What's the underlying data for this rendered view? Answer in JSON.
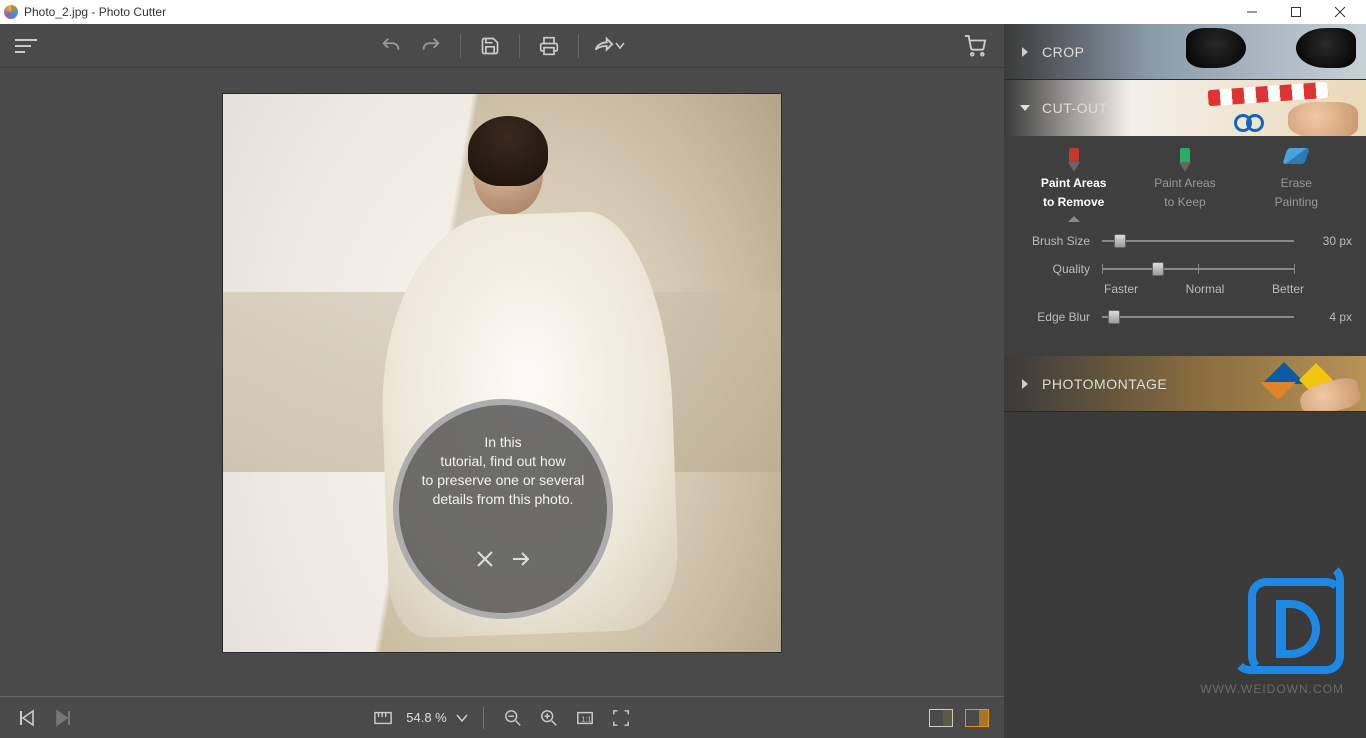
{
  "titlebar": {
    "text": "Photo_2.jpg - Photo Cutter"
  },
  "toolbar": {
    "undo": "Undo",
    "redo": "Redo",
    "save": "Save",
    "print": "Print",
    "share": "Share",
    "cart": "Store"
  },
  "tutorial": {
    "l1": "In this",
    "l2": "tutorial, find out how",
    "l3": "to preserve one or several",
    "l4": "details from this photo."
  },
  "bottombar": {
    "zoom": "54.8 %"
  },
  "panels": {
    "crop": "CROP",
    "cutout": "CUT-OUT",
    "photomontage": "PHOTOMONTAGE"
  },
  "cutout": {
    "tools": {
      "remove_l1": "Paint Areas",
      "remove_l2": "to Remove",
      "keep_l1": "Paint Areas",
      "keep_l2": "to Keep",
      "erase_l1": "Erase",
      "erase_l2": "Painting"
    },
    "brush": {
      "label": "Brush Size",
      "value": "30 px",
      "pos": 6
    },
    "quality": {
      "label": "Quality",
      "faster": "Faster",
      "normal": "Normal",
      "better": "Better",
      "pos": 28
    },
    "edge": {
      "label": "Edge Blur",
      "value": "4 px",
      "pos": 3
    }
  },
  "watermark": {
    "url": "WWW.WEIDOWN.COM"
  }
}
